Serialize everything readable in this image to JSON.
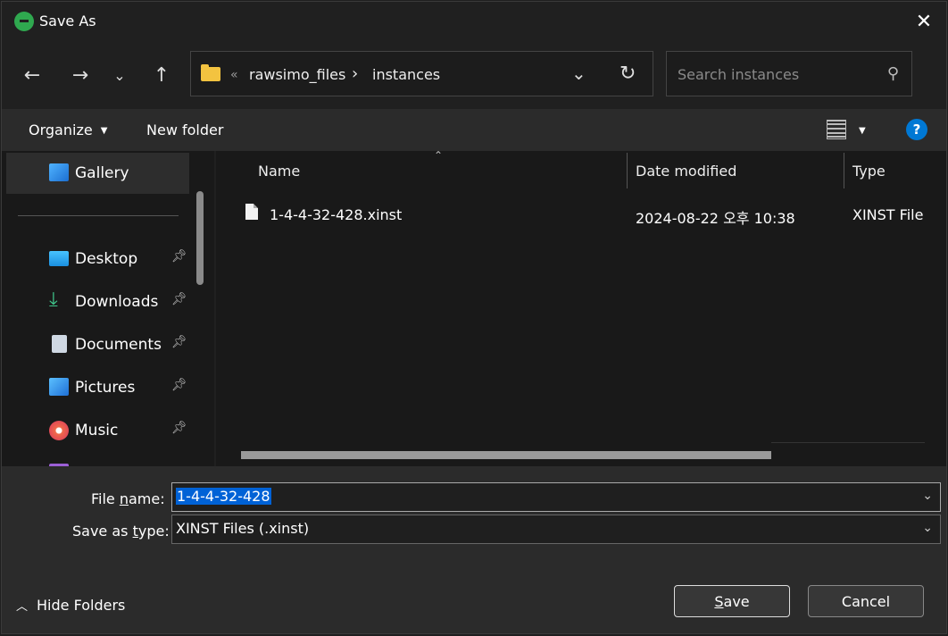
{
  "window": {
    "title": "Save As"
  },
  "address": {
    "prefix": "«",
    "crumbs": [
      "rawsimo_files",
      "instances"
    ],
    "separator": "›"
  },
  "search": {
    "placeholder": "Search instances"
  },
  "toolbar": {
    "organize": "Organize",
    "new_folder": "New folder"
  },
  "sidebar": {
    "items": [
      {
        "label": "Gallery"
      },
      {
        "label": "Desktop"
      },
      {
        "label": "Downloads"
      },
      {
        "label": "Documents"
      },
      {
        "label": "Pictures"
      },
      {
        "label": "Music"
      }
    ]
  },
  "columns": {
    "name": "Name",
    "date": "Date modified",
    "type": "Type"
  },
  "files": [
    {
      "name": "1-4-4-32-428.xinst",
      "date": "2024-08-22 오후 10:38",
      "type": "XINST File"
    }
  ],
  "form": {
    "file_name_label_pre": "File ",
    "file_name_label_u": "n",
    "file_name_label_post": "ame:",
    "file_name_value": "1-4-4-32-428",
    "save_type_label_pre": "Save as ",
    "save_type_label_u": "t",
    "save_type_label_post": "ype:",
    "save_type_value": "XINST Files (.xinst)"
  },
  "buttons": {
    "hide_folders": "Hide Folders",
    "save_u": "S",
    "save_rest": "ave",
    "cancel": "Cancel"
  },
  "colors": {
    "accent": "#0078d4",
    "selection": "#0062d6",
    "folder": "#f3c340"
  }
}
